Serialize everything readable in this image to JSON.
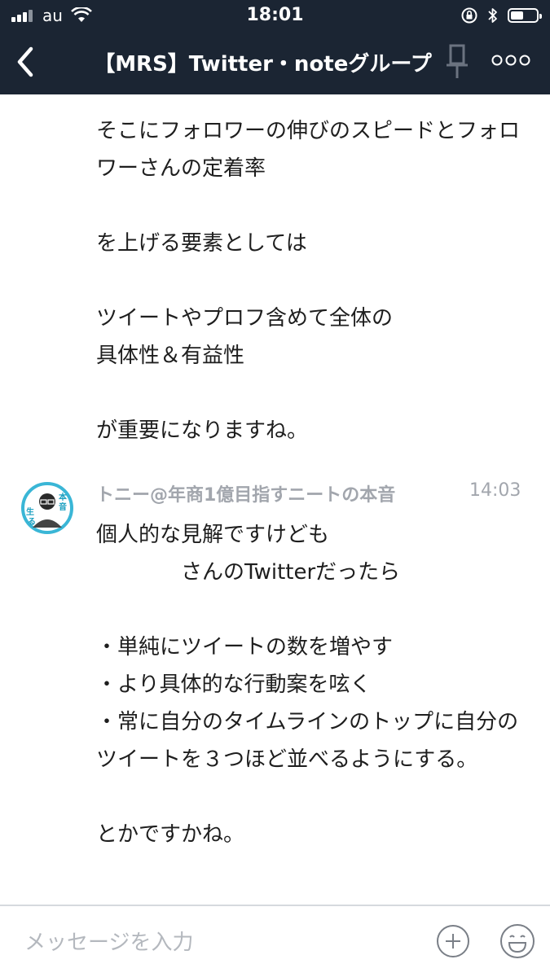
{
  "status": {
    "carrier": "au",
    "time": "18:01"
  },
  "header": {
    "title": "【MRS】Twitter・noteグループ",
    "icons": [
      "back-chevron-icon",
      "pin-icon",
      "more-icon"
    ]
  },
  "messages": [
    {
      "text": "そこにフォロワーの伸びのスピードとフォロワーさんの定着率\n\nを上げる要素としては\n\nツイートやプロフ含めて全体の\n具体性＆有益性\n\nが重要になりますね。"
    },
    {
      "sender": "トニー@年商1億目指すニートの本音",
      "time": "14:03",
      "avatar_text": "本音で生きる",
      "text": "個人的な見解ですけども\n　　　　さんのTwitterだったら\n\n・単純にツイートの数を増やす\n・より具体的な行動案を呟く\n・常に自分のタイムラインのトップに自分のツイートを３つほど並べるようにする。\n\nとかですかね。"
    }
  ],
  "input": {
    "placeholder": "メッセージを入力"
  },
  "colors": {
    "header_bg": "#1b2533",
    "meta_text": "#a2a6ad",
    "avatar_ring": "#3ab6d6"
  }
}
